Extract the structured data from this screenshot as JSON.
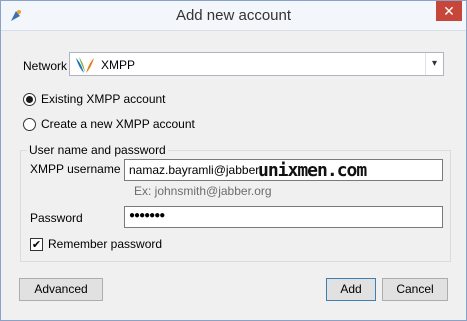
{
  "window": {
    "title": "Add new account",
    "close_symbol": "✕"
  },
  "network": {
    "label": "Network",
    "value": "XMPP",
    "logo": "xmpp-logo",
    "arrow": "▾"
  },
  "options": {
    "existing": "Existing XMPP account",
    "create_new": "Create a new XMPP account",
    "selected": "existing"
  },
  "credentials": {
    "group_title": "User name and password",
    "username_label": "XMPP username",
    "username_value": "namaz.bayramli@jabber.",
    "username_hint": "Ex: johnsmith@jabber.org",
    "password_label": "Password",
    "password_value": "●●●●●●●",
    "remember_label": "Remember password",
    "remember_checked": true,
    "checkmark": "✔"
  },
  "watermark": "unixmen.com",
  "buttons": {
    "advanced": "Advanced",
    "add": "Add",
    "cancel": "Cancel"
  },
  "colors": {
    "close": "#c7463a",
    "accent": "#3c7fb1"
  }
}
